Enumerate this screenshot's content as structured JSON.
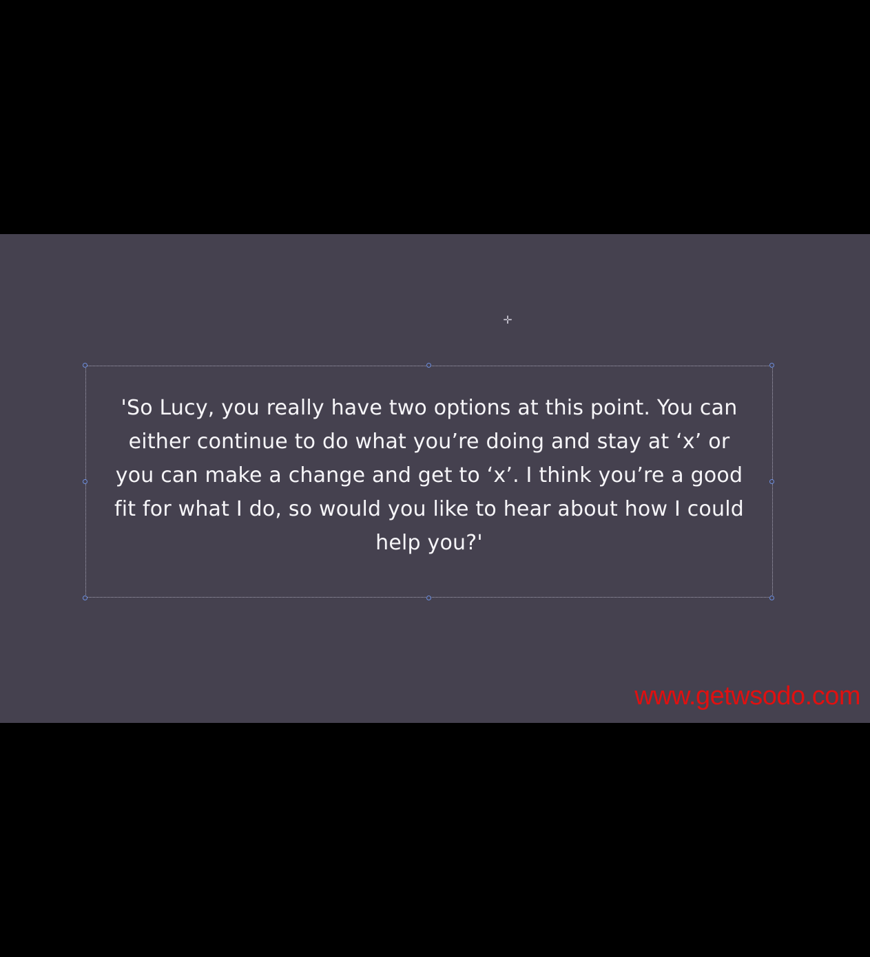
{
  "slide": {
    "quote": "'So Lucy, you really have two options at this point. You can either continue to do what you’re doing and stay at ‘x’ or you can make a change and get to ‘x’. I think you’re a good fit for what I do, so would you like to hear about how I could help you?'",
    "watermark": "www.getwsodo.com",
    "icons": {
      "crosshair": "move-crosshair-icon"
    }
  },
  "colors": {
    "letterbox": "#000000",
    "canvas": "#45414f",
    "text": "#f6f5f8",
    "selection_handle": "#6d8fe0",
    "watermark": "#e01010"
  }
}
